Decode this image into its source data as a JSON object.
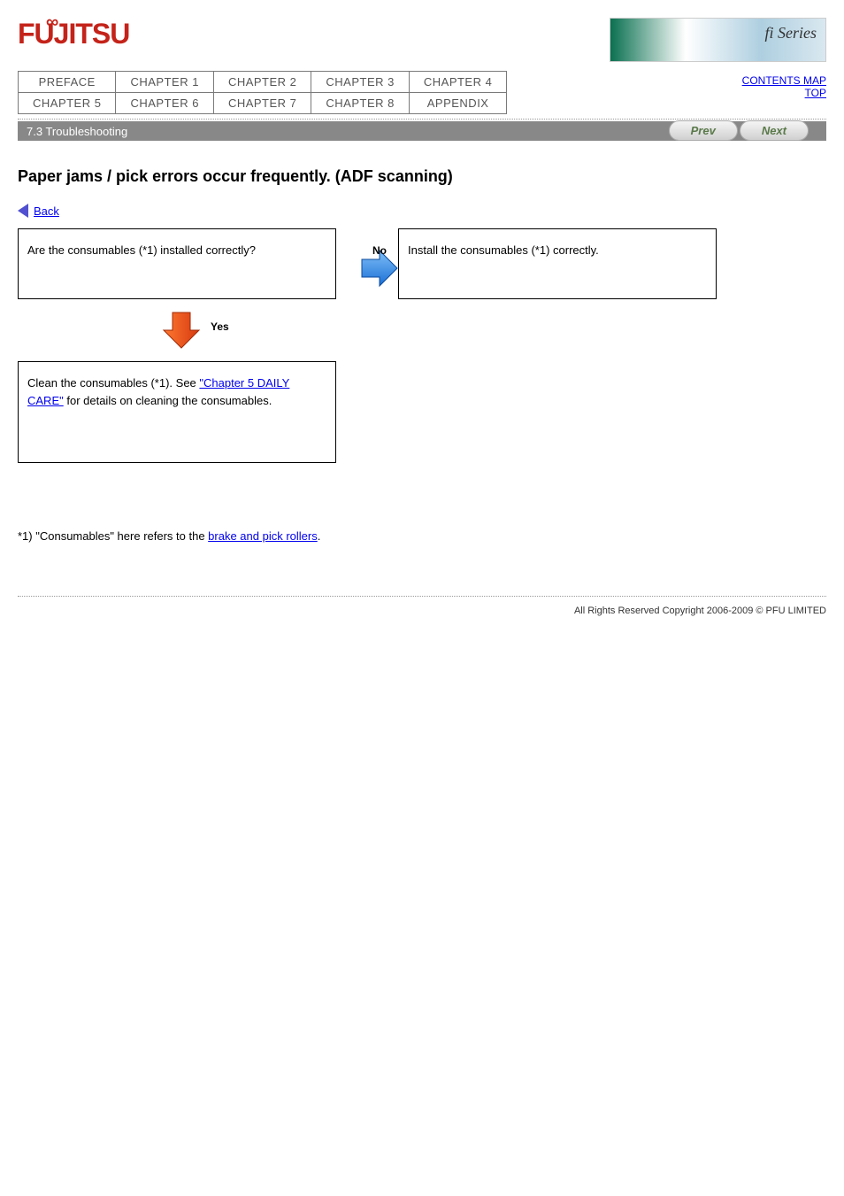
{
  "header": {
    "logo_text": "FUJITSU",
    "banner_text": "fi Series"
  },
  "nav": {
    "r1": [
      "PREFACE",
      "CHAPTER 1",
      "CHAPTER 2",
      "CHAPTER 3",
      "CHAPTER 4"
    ],
    "r2": [
      "CHAPTER 5",
      "CHAPTER 6",
      "CHAPTER 7",
      "CHAPTER 8",
      "APPENDIX"
    ]
  },
  "side": {
    "l1": "CONTENTS MAP",
    "l2": "TOP"
  },
  "bar": {
    "title": "7.3 Troubleshooting",
    "prev": "Prev",
    "next": "Next"
  },
  "section": {
    "title": "Paper jams / pick errors occur frequently. (ADF scanning)",
    "back": "Back"
  },
  "boxes": {
    "b1": "Are the consumables (*1) installed correctly?",
    "no1": "No",
    "b2": "Install the consumables (*1) correctly.",
    "yes1": "Yes",
    "b3_pre": "Clean the consumables (*1). See ",
    "b3_link": "\"Chapter 5 DAILY CARE\"",
    "b3_post": " for details on cleaning the consumables."
  },
  "note": {
    "pre": "*1) \"Consumables\" here refers to the ",
    "link": "brake and pick rollers",
    "post": "."
  },
  "footer": {
    "copyright": "All Rights Reserved Copyright 2006-2009 © PFU LIMITED"
  }
}
